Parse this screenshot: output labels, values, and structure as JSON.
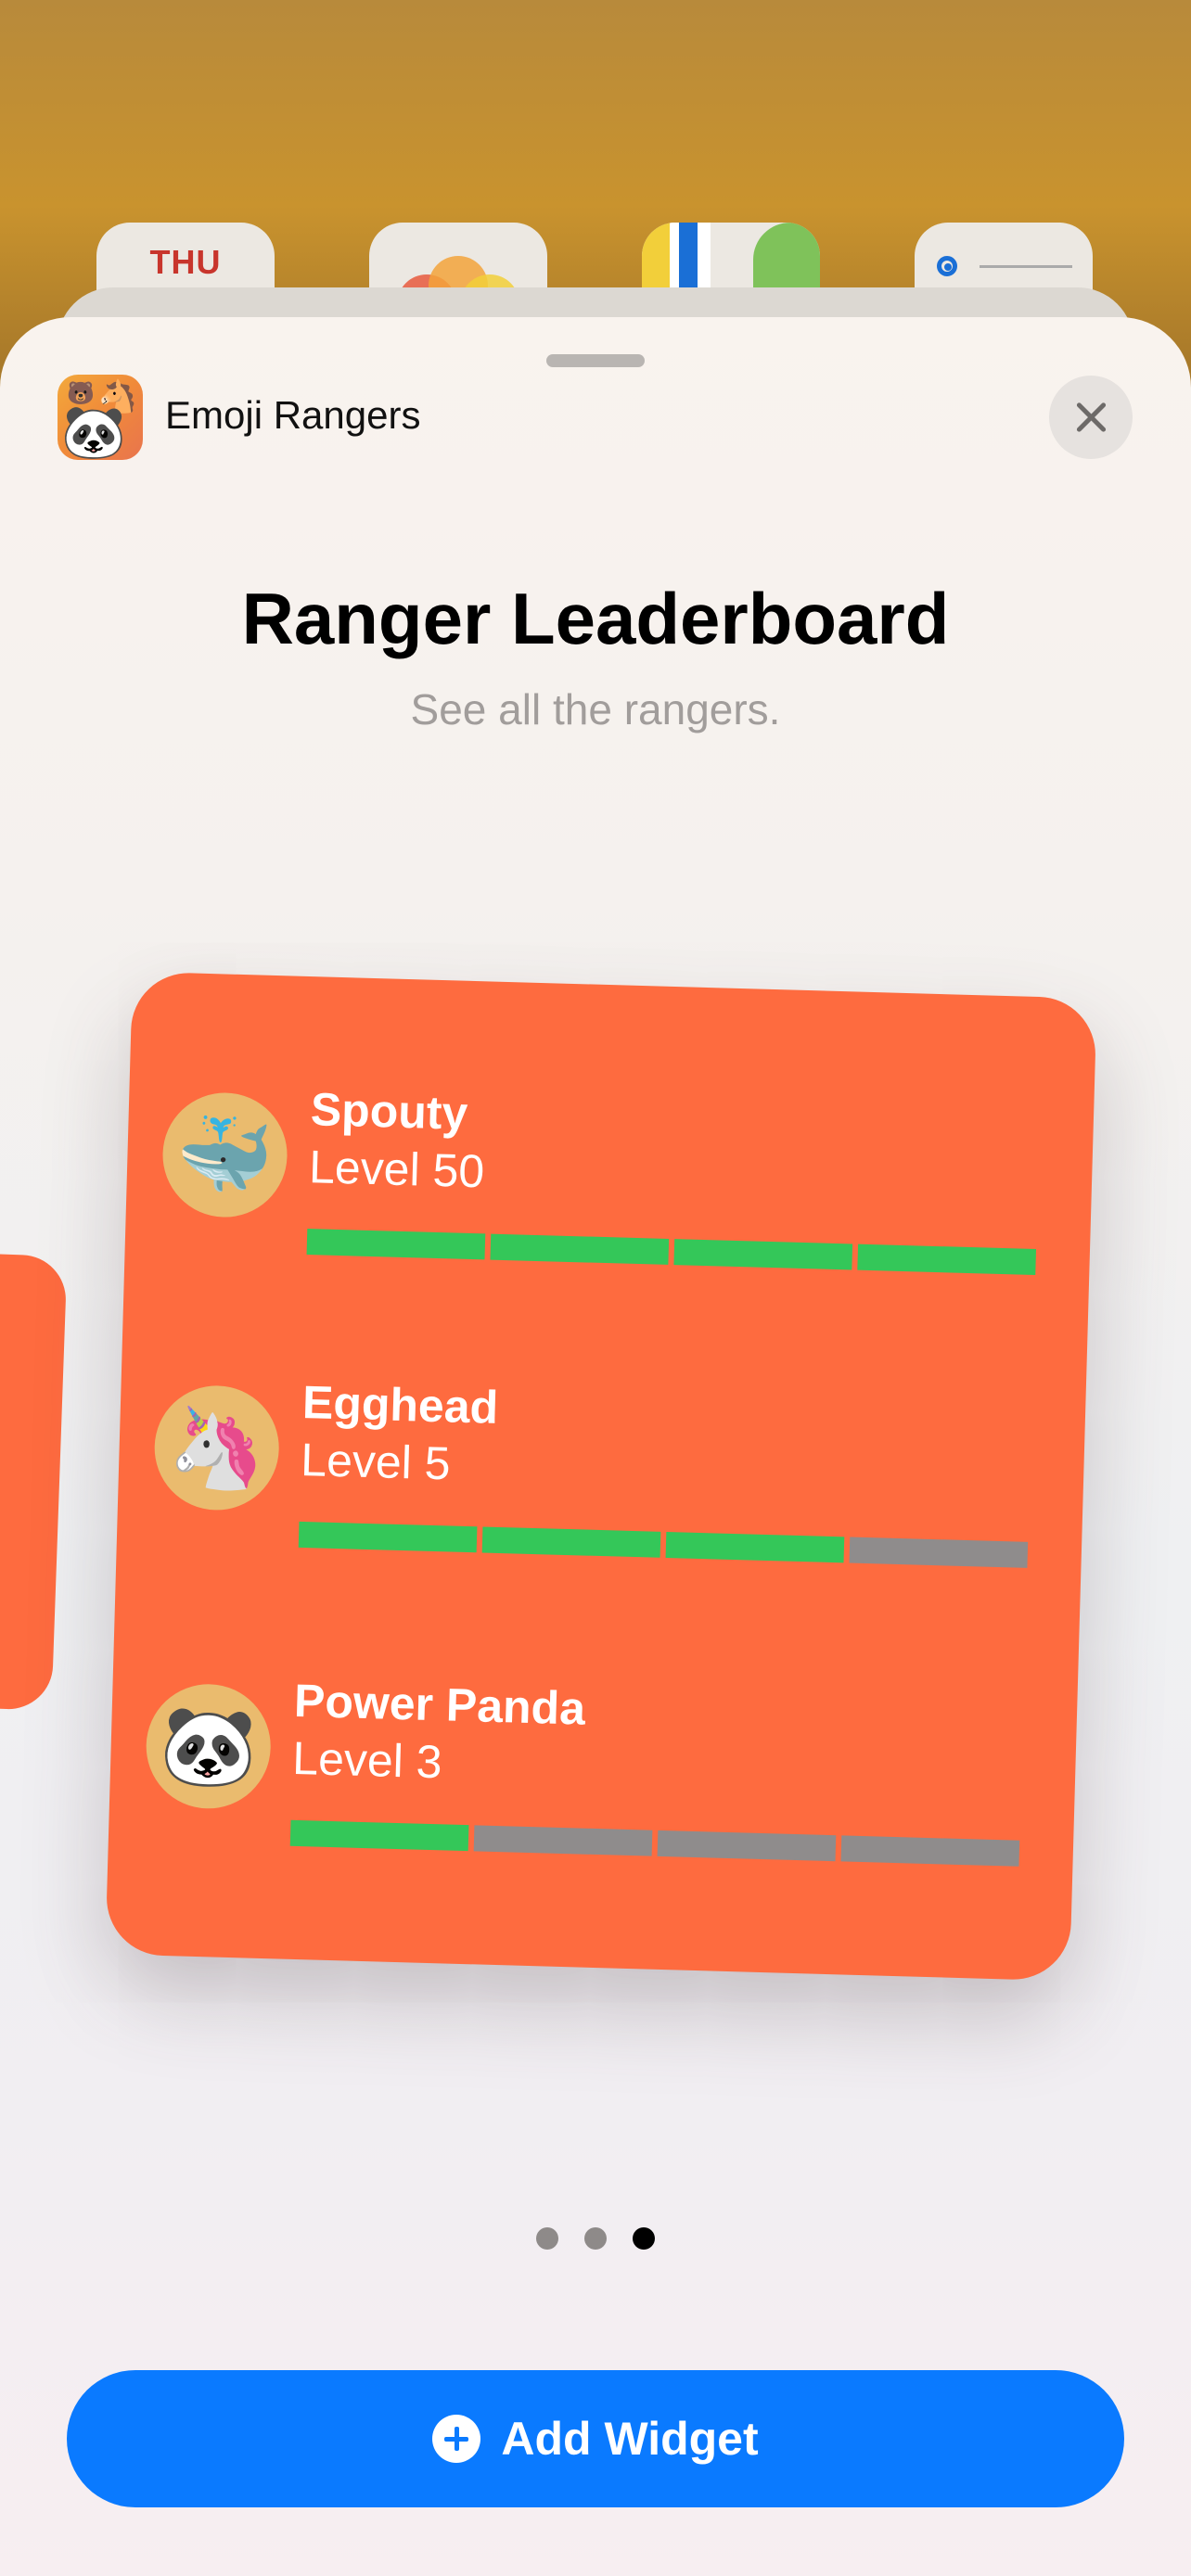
{
  "background": {
    "calendar_day": "THU"
  },
  "sheet": {
    "app_name": "Emoji Rangers",
    "app_icon": "emoji-rangers-app-icon",
    "close_icon": "close-icon"
  },
  "widget": {
    "title": "Ranger Leaderboard",
    "subtitle": "See all the rangers.",
    "rangers": [
      {
        "name": "Spouty",
        "level": "Level 50",
        "avatar": "🐳",
        "avatar_icon": "whale-avatar",
        "progress_segments_filled": 4,
        "progress_segments_total": 4
      },
      {
        "name": "Egghead",
        "level": "Level 5",
        "avatar": "🦄",
        "avatar_icon": "unicorn-avatar",
        "progress_segments_filled": 3,
        "progress_segments_total": 4
      },
      {
        "name": "Power Panda",
        "level": "Level 3",
        "avatar": "🐼",
        "avatar_icon": "panda-avatar",
        "progress_segments_filled": 1,
        "progress_segments_total": 4
      }
    ]
  },
  "pagination": {
    "pages": 3,
    "current": 3
  },
  "add_button": {
    "label": "Add Widget",
    "icon": "plus-circle-icon"
  },
  "colors": {
    "widget_bg": "#fe6b3f",
    "progress_on": "#34c759",
    "progress_off": "#8f8c8c",
    "accent": "#0a7aff"
  }
}
